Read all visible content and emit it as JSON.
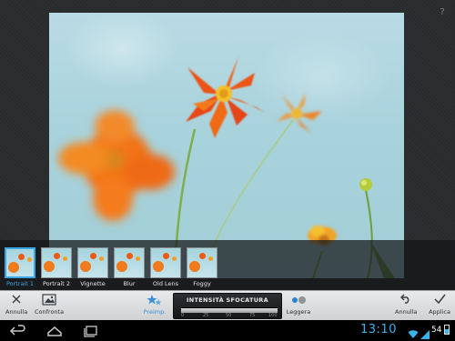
{
  "help": {
    "glyph": "?"
  },
  "filters": [
    {
      "label": "Portrait 1",
      "selected": true
    },
    {
      "label": "Portrait 2",
      "selected": false
    },
    {
      "label": "Vignette",
      "selected": false
    },
    {
      "label": "Blur",
      "selected": false
    },
    {
      "label": "Old Lens",
      "selected": false
    },
    {
      "label": "Foggy",
      "selected": false
    }
  ],
  "toolbar": {
    "cancel_label": "Annulla",
    "compare_label": "Confronta",
    "preset_label": "Preimp.",
    "blur_intensity": {
      "title": "INTENSITÀ SFOCATURA",
      "ticks": [
        "0",
        "25",
        "50",
        "75",
        "100"
      ],
      "value": 100
    },
    "light_label": "Leggera",
    "undo_label": "Annulla",
    "apply_label": "Applica"
  },
  "statusbar": {
    "time": "13:10",
    "battery_percent": "54"
  },
  "colors": {
    "accent": "#39a9e8",
    "clock": "#39b4ea"
  }
}
